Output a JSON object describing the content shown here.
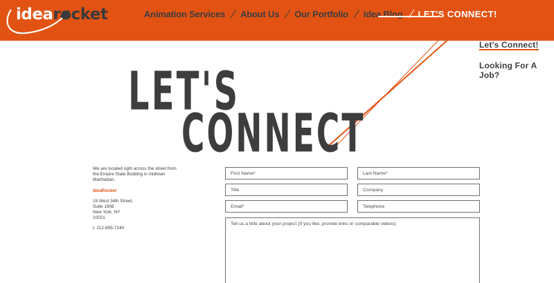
{
  "brand": {
    "logo_part1": "idea",
    "logo_part2": "rocket",
    "accent_color": "#e25313",
    "text_color": "#3d3d3f"
  },
  "nav": {
    "items": [
      {
        "label": "Animation Services"
      },
      {
        "label": "About Us"
      },
      {
        "label": "Our Portfolio"
      },
      {
        "label": "Idea Blog"
      },
      {
        "label": "LET'S CONNECT!",
        "active": true
      }
    ]
  },
  "side_nav": {
    "items": [
      {
        "label": "Let's Connect!",
        "active": true
      },
      {
        "label": "Looking For A Job?"
      }
    ]
  },
  "hero": {
    "line1": "LET'S",
    "line2": "CONNECT"
  },
  "contact": {
    "intro": "We are located right across the street from the Empire State Building in midtown Manhattan.",
    "company": "IdeaRocket",
    "address_lines": [
      "19 West 34th Street,",
      "Suite 1908",
      "New York, NY",
      "10021"
    ],
    "phone": "t: 212-695-7240"
  },
  "form": {
    "first_name_placeholder": "First Name*",
    "last_name_placeholder": "Last Name*",
    "title_placeholder": "Title",
    "company_placeholder": "Company",
    "email_placeholder": "Email*",
    "telephone_placeholder": "Telephone",
    "project_placeholder": "Tell us a little about your project (If you like, provide links or comparable videos)"
  }
}
